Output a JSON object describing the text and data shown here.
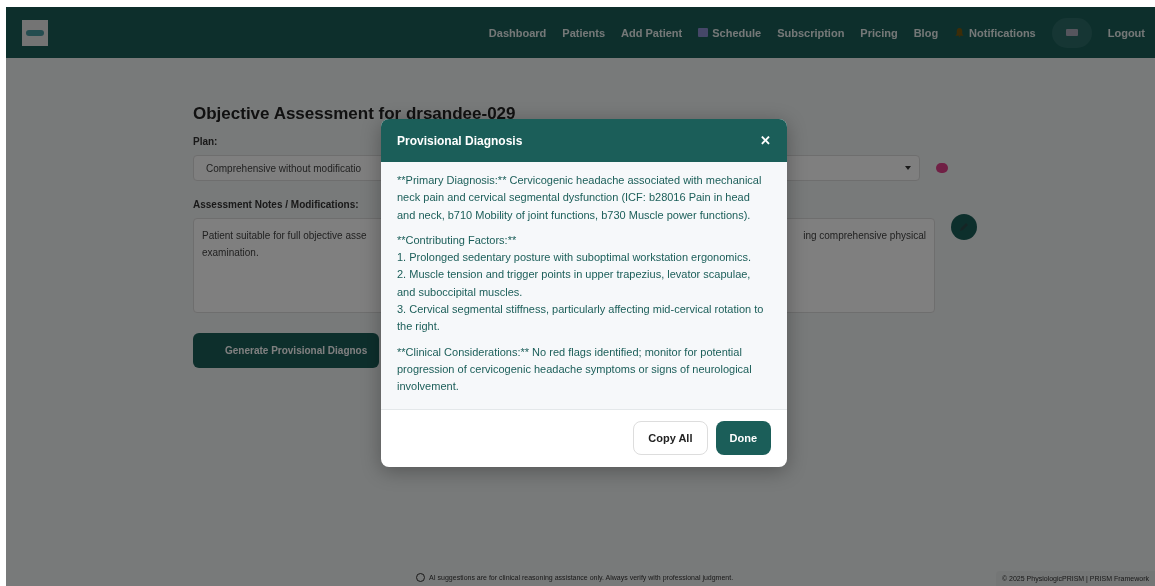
{
  "navbar": {
    "items": [
      {
        "label": "Dashboard",
        "kind": "plain"
      },
      {
        "label": "Patients",
        "kind": "plain"
      },
      {
        "label": "Add Patient",
        "kind": "plain"
      },
      {
        "label": "Schedule",
        "kind": "calendar"
      },
      {
        "label": "Subscription",
        "kind": "plain"
      },
      {
        "label": "Pricing",
        "kind": "plain"
      },
      {
        "label": "Blog",
        "kind": "plain"
      },
      {
        "label": "Notifications",
        "kind": "bell"
      }
    ],
    "logout": "Logout"
  },
  "page": {
    "title": "Objective Assessment for drsandee-029",
    "plan_label": "Plan:",
    "plan_value": "Comprehensive without modificatio",
    "notes_label": "Assessment Notes / Modifications:",
    "notes_left": "Patient suitable for full objective asse",
    "notes_right": "ing comprehensive physical",
    "notes_line2": "examination.",
    "generate_button": "Generate Provisional Diagnos"
  },
  "footer": {
    "disclaimer": "AI suggestions are for clinical reasoning assistance only. Always verify with professional judgment.",
    "copyright": "© 2025 PhysiologicPRISM | PRISM Framework"
  },
  "modal": {
    "title": "Provisional Diagnosis",
    "close": "✕",
    "paragraphs": [
      {
        "lines": [
          "**Primary Diagnosis:** Cervicogenic headache associated with mechanical neck pain and cervical segmental dysfunction (ICF: b28016 Pain in head and neck, b710 Mobility of joint functions, b730 Muscle power functions)."
        ]
      },
      {
        "lines": [
          "**Contributing Factors:**",
          "1. Prolonged sedentary posture with suboptimal workstation ergonomics.",
          "2. Muscle tension and trigger points in upper trapezius, levator scapulae, and suboccipital muscles.",
          "3. Cervical segmental stiffness, particularly affecting mid-cervical rotation to the right."
        ]
      },
      {
        "lines": [
          "**Clinical Considerations:** No red flags identified; monitor for potential progression of cervicogenic headache symptoms or signs of neurological involvement."
        ]
      }
    ],
    "buttons": [
      {
        "label": "Copy All",
        "kind": "secondary"
      },
      {
        "label": "Done",
        "kind": "primary"
      }
    ]
  }
}
